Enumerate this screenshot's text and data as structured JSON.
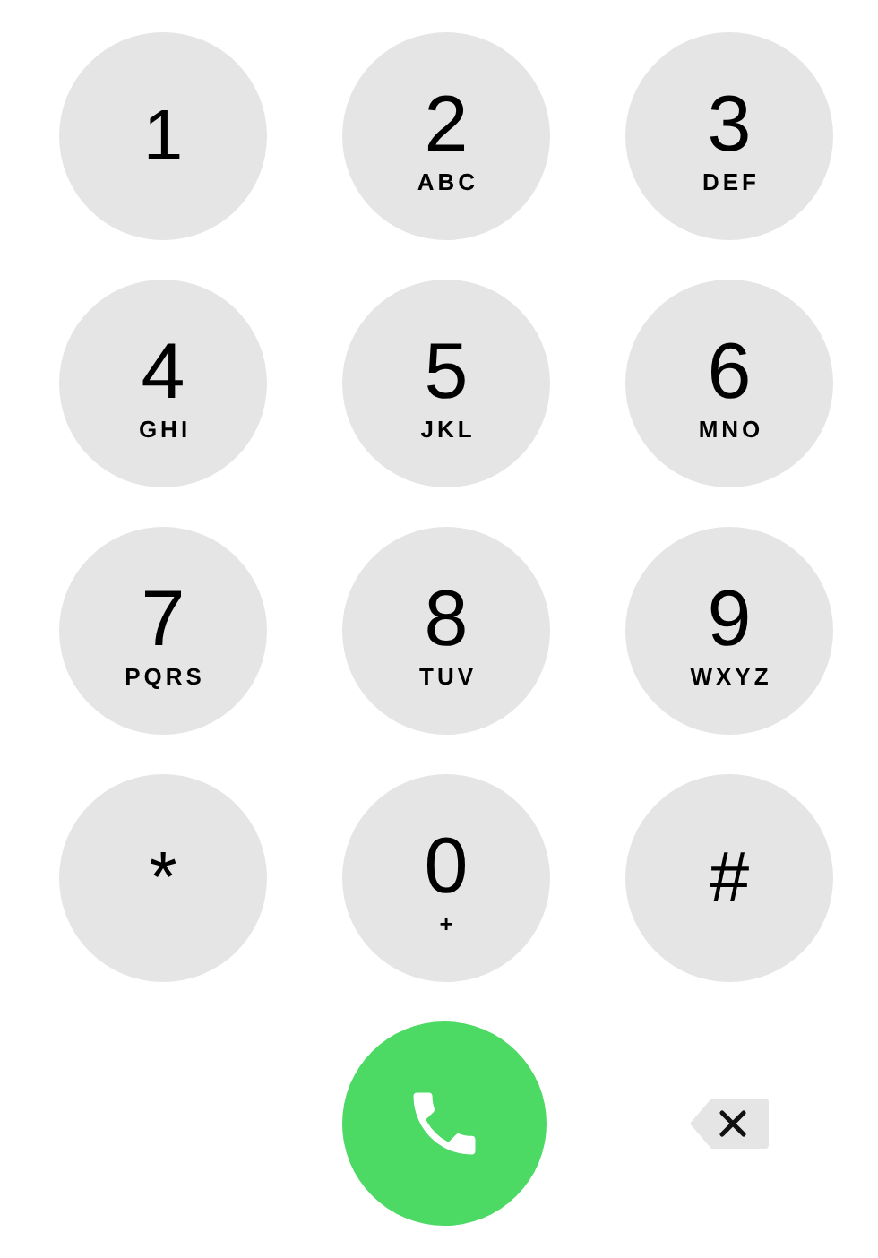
{
  "keys": [
    {
      "digit": "1"
    },
    {
      "digit": "2",
      "letters": "ABC"
    },
    {
      "digit": "3",
      "letters": "DEF"
    },
    {
      "digit": "4",
      "letters": "GHI"
    },
    {
      "digit": "5",
      "letters": "JKL"
    },
    {
      "digit": "6",
      "letters": "MNO"
    },
    {
      "digit": "7",
      "letters": "PQRS"
    },
    {
      "digit": "8",
      "letters": "TUV"
    },
    {
      "digit": "9",
      "letters": "WXYZ"
    },
    {
      "digit": "*"
    },
    {
      "digit": "0",
      "letters": "+"
    },
    {
      "digit": "#"
    }
  ]
}
